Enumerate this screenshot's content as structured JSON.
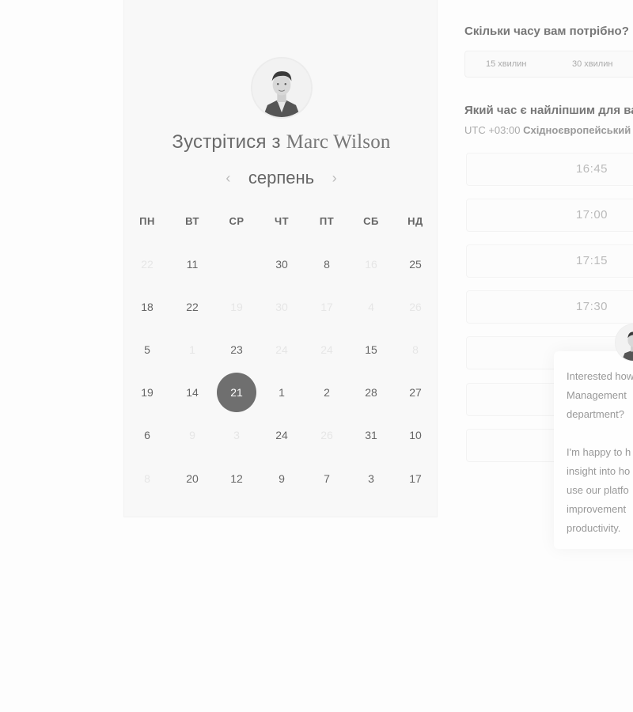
{
  "calendar": {
    "title_prefix": "Зустрітися з",
    "host_name": "Marc Wilson",
    "month": "серпень",
    "prev_arrow": "‹",
    "next_arrow": "›",
    "weekdays": [
      "ПН",
      "ВТ",
      "СР",
      "ЧТ",
      "ПТ",
      "СБ",
      "НД"
    ],
    "weeks": [
      [
        {
          "d": "22",
          "s": "disabled"
        },
        {
          "d": "11",
          "s": "active"
        },
        {
          "d": "",
          "s": "disabled"
        },
        {
          "d": "30",
          "s": "active"
        },
        {
          "d": "8",
          "s": "active"
        },
        {
          "d": "16",
          "s": "disabled"
        },
        {
          "d": "25",
          "s": "active"
        }
      ],
      [
        {
          "d": "18",
          "s": "active"
        },
        {
          "d": "22",
          "s": "active"
        },
        {
          "d": "19",
          "s": "disabled"
        },
        {
          "d": "30",
          "s": "disabled"
        },
        {
          "d": "17",
          "s": "disabled"
        },
        {
          "d": "4",
          "s": "disabled"
        },
        {
          "d": "26",
          "s": "disabled"
        }
      ],
      [
        {
          "d": "5",
          "s": "active"
        },
        {
          "d": "1",
          "s": "disabled"
        },
        {
          "d": "23",
          "s": "active"
        },
        {
          "d": "24",
          "s": "disabled"
        },
        {
          "d": "24",
          "s": "disabled"
        },
        {
          "d": "15",
          "s": "active"
        },
        {
          "d": "8",
          "s": "disabled"
        }
      ],
      [
        {
          "d": "19",
          "s": "active"
        },
        {
          "d": "14",
          "s": "active"
        },
        {
          "d": "21",
          "s": "selected"
        },
        {
          "d": "1",
          "s": "active"
        },
        {
          "d": "2",
          "s": "active"
        },
        {
          "d": "28",
          "s": "active"
        },
        {
          "d": "27",
          "s": "active"
        }
      ],
      [
        {
          "d": "6",
          "s": "active"
        },
        {
          "d": "9",
          "s": "disabled"
        },
        {
          "d": "3",
          "s": "disabled"
        },
        {
          "d": "24",
          "s": "active"
        },
        {
          "d": "26",
          "s": "disabled"
        },
        {
          "d": "31",
          "s": "active"
        },
        {
          "d": "10",
          "s": "active"
        }
      ],
      [
        {
          "d": "8",
          "s": "disabled"
        },
        {
          "d": "20",
          "s": "active"
        },
        {
          "d": "12",
          "s": "active"
        },
        {
          "d": "9",
          "s": "active"
        },
        {
          "d": "7",
          "s": "active"
        },
        {
          "d": "3",
          "s": "active"
        },
        {
          "d": "17",
          "s": "active"
        }
      ]
    ]
  },
  "booking": {
    "duration_question": "Скільки часу вам потрібно?",
    "durations": [
      "15 хвилин",
      "30 хвилин"
    ],
    "time_question": "Який час є найліпшим для вас?",
    "timezone_offset": "UTC +03:00",
    "timezone_name": "Східноєвропейський",
    "slots": [
      "16:45",
      "17:00",
      "17:15",
      "17:30",
      "",
      "",
      ""
    ]
  },
  "chat": {
    "paragraph1": "Interested how\nManagement\ndepartment?",
    "paragraph2": "I'm happy to h\ninsight into ho\nuse our platfo\nimprovement\nproductivity."
  }
}
